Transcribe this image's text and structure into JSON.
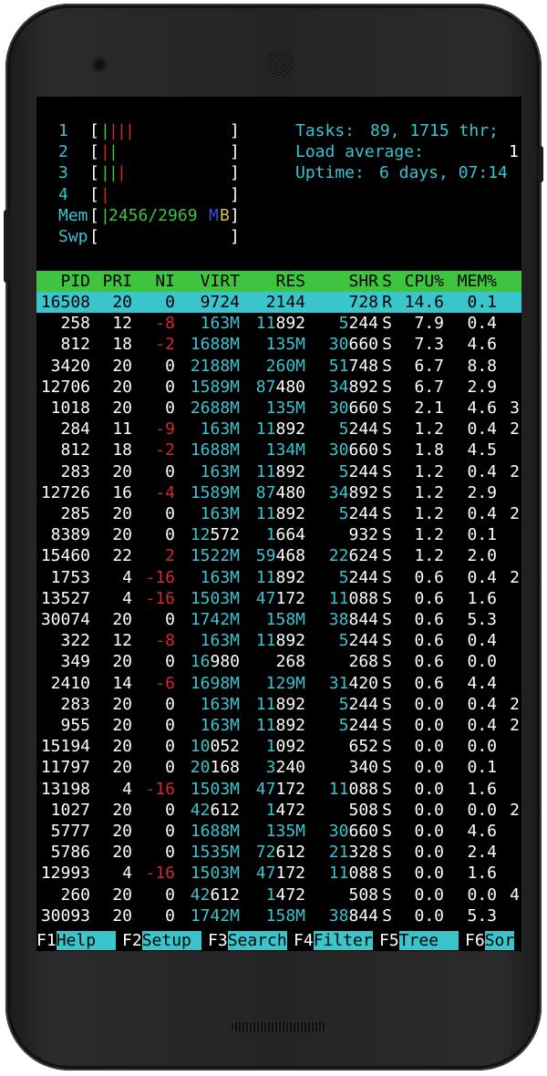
{
  "meters": {
    "cpu": [
      {
        "label": "1",
        "bars": "||||"
      },
      {
        "label": "2",
        "bars": "||"
      },
      {
        "label": "3",
        "bars": "|||"
      },
      {
        "label": "4",
        "bars": "|"
      }
    ],
    "mem": {
      "label": "Mem",
      "value": "2456/2969",
      "unit_m": "M",
      "unit_b": "B"
    },
    "swp": {
      "label": "Swp"
    }
  },
  "summary": {
    "tasks_label": "Tasks:",
    "tasks_value": "89, 1715 thr;",
    "load_label": "Load average:",
    "load_value": "1",
    "uptime_label": "Uptime:",
    "uptime_value": "6 days, 07:14"
  },
  "columns": [
    "PID",
    "PRI",
    "NI",
    "VIRT",
    "RES",
    "SHR",
    "S",
    "CPU%",
    "MEM%"
  ],
  "rows": [
    {
      "pid": "16508",
      "pri": "20",
      "ni": "0",
      "virt": "9724",
      "res": "2144",
      "shr": "728",
      "s": "R",
      "cpu": "14.6",
      "mem": "0.1",
      "extra": ""
    },
    {
      "pid": "258",
      "pri": "12",
      "ni": "-8",
      "virt": "163M",
      "res": "11892",
      "shr": "5244",
      "s": "S",
      "cpu": "7.9",
      "mem": "0.4",
      "extra": ""
    },
    {
      "pid": "812",
      "pri": "18",
      "ni": "-2",
      "virt": "1688M",
      "res": "135M",
      "shr": "30660",
      "s": "S",
      "cpu": "7.3",
      "mem": "4.6",
      "extra": ""
    },
    {
      "pid": "3420",
      "pri": "20",
      "ni": "0",
      "virt": "2188M",
      "res": "260M",
      "shr": "51748",
      "s": "S",
      "cpu": "6.7",
      "mem": "8.8",
      "extra": ""
    },
    {
      "pid": "12706",
      "pri": "20",
      "ni": "0",
      "virt": "1589M",
      "res": "87480",
      "shr": "34892",
      "s": "S",
      "cpu": "6.7",
      "mem": "2.9",
      "extra": ""
    },
    {
      "pid": "1018",
      "pri": "20",
      "ni": "0",
      "virt": "2688M",
      "res": "135M",
      "shr": "30660",
      "s": "S",
      "cpu": "2.1",
      "mem": "4.6",
      "extra": "3"
    },
    {
      "pid": "284",
      "pri": "11",
      "ni": "-9",
      "virt": "163M",
      "res": "11892",
      "shr": "5244",
      "s": "S",
      "cpu": "1.2",
      "mem": "0.4",
      "extra": "2"
    },
    {
      "pid": "812",
      "pri": "18",
      "ni": "-2",
      "virt": "1688M",
      "res": "134M",
      "shr": "30660",
      "s": "S",
      "cpu": "1.8",
      "mem": "4.5",
      "extra": ""
    },
    {
      "pid": "283",
      "pri": "20",
      "ni": "0",
      "virt": "163M",
      "res": "11892",
      "shr": "5244",
      "s": "S",
      "cpu": "1.2",
      "mem": "0.4",
      "extra": "2"
    },
    {
      "pid": "12726",
      "pri": "16",
      "ni": "-4",
      "virt": "1589M",
      "res": "87480",
      "shr": "34892",
      "s": "S",
      "cpu": "1.2",
      "mem": "2.9",
      "extra": ""
    },
    {
      "pid": "285",
      "pri": "20",
      "ni": "0",
      "virt": "163M",
      "res": "11892",
      "shr": "5244",
      "s": "S",
      "cpu": "1.2",
      "mem": "0.4",
      "extra": "2"
    },
    {
      "pid": "8389",
      "pri": "20",
      "ni": "0",
      "virt": "12572",
      "res": "1664",
      "shr": "932",
      "s": "S",
      "cpu": "1.2",
      "mem": "0.1",
      "extra": ""
    },
    {
      "pid": "15460",
      "pri": "22",
      "ni": "2",
      "virt": "1522M",
      "res": "59468",
      "shr": "22624",
      "s": "S",
      "cpu": "1.2",
      "mem": "2.0",
      "extra": ""
    },
    {
      "pid": "1753",
      "pri": "4",
      "ni": "-16",
      "virt": "163M",
      "res": "11892",
      "shr": "5244",
      "s": "S",
      "cpu": "0.6",
      "mem": "0.4",
      "extra": "2"
    },
    {
      "pid": "13527",
      "pri": "4",
      "ni": "-16",
      "virt": "1503M",
      "res": "47172",
      "shr": "11088",
      "s": "S",
      "cpu": "0.6",
      "mem": "1.6",
      "extra": ""
    },
    {
      "pid": "30074",
      "pri": "20",
      "ni": "0",
      "virt": "1742M",
      "res": "158M",
      "shr": "38844",
      "s": "S",
      "cpu": "0.6",
      "mem": "5.3",
      "extra": ""
    },
    {
      "pid": "322",
      "pri": "12",
      "ni": "-8",
      "virt": "163M",
      "res": "11892",
      "shr": "5244",
      "s": "S",
      "cpu": "0.6",
      "mem": "0.4",
      "extra": ""
    },
    {
      "pid": "349",
      "pri": "20",
      "ni": "0",
      "virt": "16980",
      "res": "268",
      "shr": "268",
      "s": "S",
      "cpu": "0.6",
      "mem": "0.0",
      "extra": ""
    },
    {
      "pid": "2410",
      "pri": "14",
      "ni": "-6",
      "virt": "1698M",
      "res": "129M",
      "shr": "31420",
      "s": "S",
      "cpu": "0.6",
      "mem": "4.4",
      "extra": ""
    },
    {
      "pid": "283",
      "pri": "20",
      "ni": "0",
      "virt": "163M",
      "res": "11892",
      "shr": "5244",
      "s": "S",
      "cpu": "0.0",
      "mem": "0.4",
      "extra": "2"
    },
    {
      "pid": "955",
      "pri": "20",
      "ni": "0",
      "virt": "163M",
      "res": "11892",
      "shr": "5244",
      "s": "S",
      "cpu": "0.0",
      "mem": "0.4",
      "extra": "2"
    },
    {
      "pid": "15194",
      "pri": "20",
      "ni": "0",
      "virt": "10052",
      "res": "1092",
      "shr": "652",
      "s": "S",
      "cpu": "0.0",
      "mem": "0.0",
      "extra": ""
    },
    {
      "pid": "11797",
      "pri": "20",
      "ni": "0",
      "virt": "20168",
      "res": "3240",
      "shr": "340",
      "s": "S",
      "cpu": "0.0",
      "mem": "0.1",
      "extra": ""
    },
    {
      "pid": "13198",
      "pri": "4",
      "ni": "-16",
      "virt": "1503M",
      "res": "47172",
      "shr": "11088",
      "s": "S",
      "cpu": "0.0",
      "mem": "1.6",
      "extra": ""
    },
    {
      "pid": "1027",
      "pri": "20",
      "ni": "0",
      "virt": "42612",
      "res": "1472",
      "shr": "508",
      "s": "S",
      "cpu": "0.0",
      "mem": "0.0",
      "extra": "2"
    },
    {
      "pid": "5777",
      "pri": "20",
      "ni": "0",
      "virt": "1688M",
      "res": "135M",
      "shr": "30660",
      "s": "S",
      "cpu": "0.0",
      "mem": "4.6",
      "extra": ""
    },
    {
      "pid": "5786",
      "pri": "20",
      "ni": "0",
      "virt": "1535M",
      "res": "72612",
      "shr": "21328",
      "s": "S",
      "cpu": "0.0",
      "mem": "2.4",
      "extra": ""
    },
    {
      "pid": "12993",
      "pri": "4",
      "ni": "-16",
      "virt": "1503M",
      "res": "47172",
      "shr": "11088",
      "s": "S",
      "cpu": "0.0",
      "mem": "1.6",
      "extra": ""
    },
    {
      "pid": "260",
      "pri": "20",
      "ni": "0",
      "virt": "42612",
      "res": "1472",
      "shr": "508",
      "s": "S",
      "cpu": "0.0",
      "mem": "0.0",
      "extra": "4"
    },
    {
      "pid": "30093",
      "pri": "20",
      "ni": "0",
      "virt": "1742M",
      "res": "158M",
      "shr": "38844",
      "s": "S",
      "cpu": "0.0",
      "mem": "5.3",
      "extra": ""
    }
  ],
  "function_keys": [
    {
      "key": "F1",
      "label": "Help  "
    },
    {
      "key": "F2",
      "label": "Setup "
    },
    {
      "key": "F3",
      "label": "Search"
    },
    {
      "key": "F4",
      "label": "Filter"
    },
    {
      "key": "F5",
      "label": "Tree  "
    },
    {
      "key": "F6",
      "label": "Sor"
    }
  ],
  "colors": {
    "header_bg": "#3ec43e",
    "selection_bg": "#3ac4cc",
    "cyan": "#3ac4d0",
    "red": "#d02a2a"
  }
}
